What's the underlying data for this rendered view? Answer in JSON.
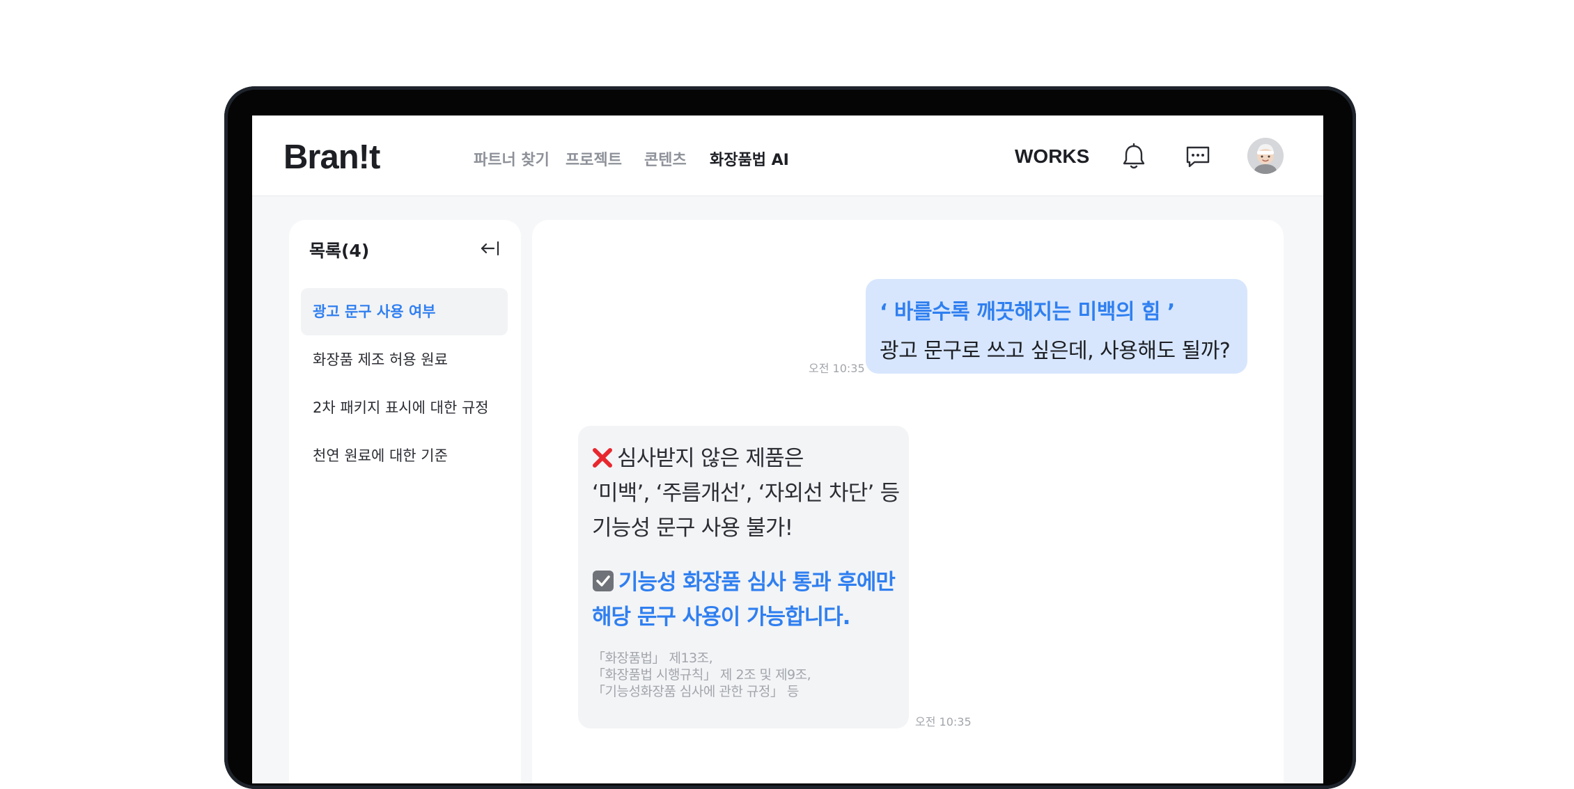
{
  "header": {
    "logo": "Bran!t",
    "nav": [
      "파트너 찾기",
      "프로젝트",
      "콘텐츠",
      "화장품법 AI"
    ],
    "active_nav": "화장품법 AI",
    "works_label": "WORKS",
    "icons": [
      "bell-icon",
      "chat-bubble-icon",
      "avatar"
    ]
  },
  "sidebar": {
    "title": "목록(4)",
    "collapse_icon": "collapse-left-icon",
    "items": [
      {
        "label": "광고 문구 사용 여부",
        "active": true
      },
      {
        "label": "화장품 제조 허용 원료",
        "active": false
      },
      {
        "label": "2차 패키지 표시에 대한 규정",
        "active": false
      },
      {
        "label": "천연 원료에 대한 기준",
        "active": false
      }
    ]
  },
  "chat": {
    "user_message": {
      "quote": "‘ 바를수록 깨끗해지는 미백의 힘 ’",
      "text": "광고 문구로 쓰고 싶은데, 사용해도 될까?",
      "time": "오전 10:35"
    },
    "bot_message": {
      "line1": "심사받지 않은 제품은",
      "line2": "‘미백’, ‘주름개선’, ‘자외선 차단’ 등",
      "line3": "기능성 문구 사용 불가!",
      "strong1": "기능성 화장품 심사 통과 후에만",
      "strong2": "해당 문구 사용이 가능합니다.",
      "refs": [
        "「화장품법」 제13조,",
        "「화장품법 시행규칙」 제 2조  및 제9조,",
        "「기능성화장품 심사에 관한 규정」 등"
      ],
      "time": "오전 10:35"
    }
  }
}
